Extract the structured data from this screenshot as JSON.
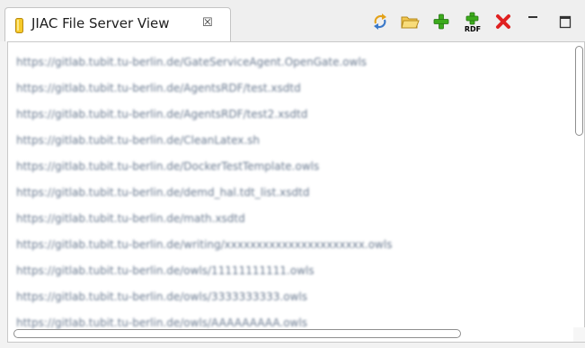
{
  "tab": {
    "title": "JIAC File Server View",
    "close_symbol": "☒",
    "icon": "jar-icon"
  },
  "toolbar": {
    "buttons": [
      {
        "icon": "sync-icon"
      },
      {
        "icon": "open-folder-icon"
      },
      {
        "icon": "add-icon"
      },
      {
        "icon": "add-rdf-icon",
        "label": "RDF"
      },
      {
        "icon": "delete-icon"
      },
      {
        "icon": "minimize-icon"
      },
      {
        "icon": "maximize-icon"
      }
    ]
  },
  "file_list": {
    "items": [
      "https://gitlab.tubit.tu-berlin.de/GateServiceAgent.OpenGate.owls",
      "https://gitlab.tubit.tu-berlin.de/AgentsRDF/test.xsdtd",
      "https://gitlab.tubit.tu-berlin.de/AgentsRDF/test2.xsdtd",
      "https://gitlab.tubit.tu-berlin.de/CleanLatex.sh",
      "https://gitlab.tubit.tu-berlin.de/DockerTestTemplate.owls",
      "https://gitlab.tubit.tu-berlin.de/demd_hal.tdt_list.xsdtd",
      "https://gitlab.tubit.tu-berlin.de/math.xsdtd",
      "https://gitlab.tubit.tu-berlin.de/writing/xxxxxxxxxxxxxxxxxxxxxx.owls",
      "https://gitlab.tubit.tu-berlin.de/owls/11111111111.owls",
      "https://gitlab.tubit.tu-berlin.de/owls/3333333333.owls",
      "https://gitlab.tubit.tu-berlin.de/owls/AAAAAAAAA.owls"
    ]
  },
  "colors": {
    "delete": "#e02020",
    "add": "#3cab1c",
    "folder": "#e8b830",
    "jar": "#f0c020"
  }
}
